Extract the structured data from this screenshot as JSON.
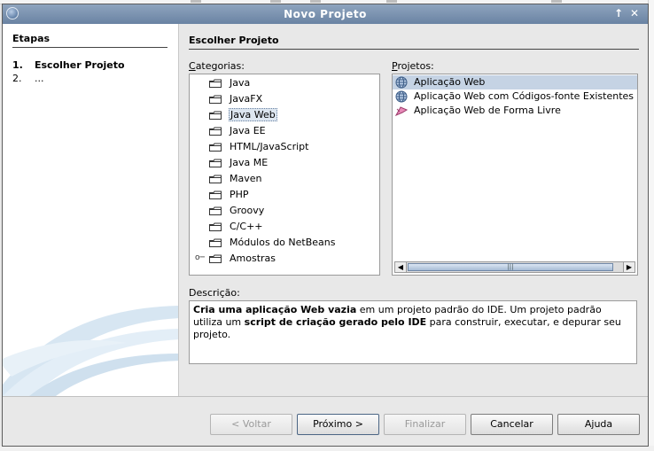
{
  "window": {
    "title": "Novo Projeto",
    "controls": [
      "↑",
      "✕"
    ]
  },
  "steps": {
    "heading": "Etapas",
    "items": [
      {
        "num": "1.",
        "label": "Escolher Projeto"
      },
      {
        "num": "2.",
        "label": "..."
      }
    ]
  },
  "main": {
    "heading": "Escolher Projeto",
    "categories_label_pre": "",
    "categories_label_u": "C",
    "categories_label_post": "ategorias:",
    "projects_label_u": "P",
    "projects_label_post": "rojetos:",
    "description_label": "Descrição:",
    "categories": [
      "Java",
      "JavaFX",
      "Java Web",
      "Java EE",
      "HTML/JavaScript",
      "Java ME",
      "Maven",
      "PHP",
      "Groovy",
      "C/C++",
      "Módulos do NetBeans",
      "Amostras"
    ],
    "selected_category": "Java Web",
    "projects": [
      {
        "label": "Aplicação Web",
        "icon": "globe-icon"
      },
      {
        "label": "Aplicação Web com Códigos-fonte Existentes",
        "icon": "globe-icon"
      },
      {
        "label": "Aplicação Web de Forma Livre",
        "icon": "free-form-icon"
      }
    ],
    "selected_project": "Aplicação Web",
    "description": {
      "b1": "Cria uma aplicação Web vazia",
      "t1": " em um projeto padrão do IDE. Um projeto padrão utiliza um ",
      "b2": "script de criação gerado pelo IDE",
      "t2": " para construir, executar, e depurar seu projeto."
    },
    "scroll_grip": "|||"
  },
  "buttons": {
    "back": "< Voltar",
    "next": "Próximo >",
    "finish": "Finalizar",
    "cancel": "Cancelar",
    "help": "Ajuda"
  },
  "colors": {
    "titlebar": "#7890ae",
    "selection": "#c5d3e4",
    "panel": "#e8e8e8"
  }
}
